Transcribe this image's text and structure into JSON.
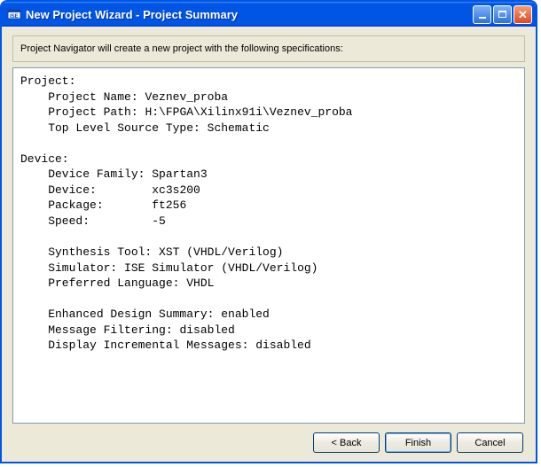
{
  "window": {
    "title": "New Project Wizard - Project Summary"
  },
  "intro": "Project Navigator will create a new project with the following specifications:",
  "summary": {
    "project_heading": "Project:",
    "project_name_label": "    Project Name: ",
    "project_name_value": "Veznev_proba",
    "project_path_label": "    Project Path: ",
    "project_path_value": "H:\\FPGA\\Xilinx91i\\Veznev_proba",
    "top_level_label": "    Top Level Source Type: ",
    "top_level_value": "Schematic",
    "device_heading": "Device:",
    "device_family_label": "    Device Family: ",
    "device_family_value": "Spartan3",
    "device_label": "    Device:        ",
    "device_value": "xc3s200",
    "package_label": "    Package:       ",
    "package_value": "ft256",
    "speed_label": "    Speed:         ",
    "speed_value": "-5",
    "synth_label": "    Synthesis Tool: ",
    "synth_value": "XST (VHDL/Verilog)",
    "sim_label": "    Simulator: ",
    "sim_value": "ISE Simulator (VHDL/Verilog)",
    "lang_label": "    Preferred Language: ",
    "lang_value": "VHDL",
    "eds_label": "    Enhanced Design Summary: ",
    "eds_value": "enabled",
    "mf_label": "    Message Filtering: ",
    "mf_value": "disabled",
    "dim_label": "    Display Incremental Messages: ",
    "dim_value": "disabled"
  },
  "buttons": {
    "back": "< Back",
    "finish": "Finish",
    "cancel": "Cancel"
  }
}
